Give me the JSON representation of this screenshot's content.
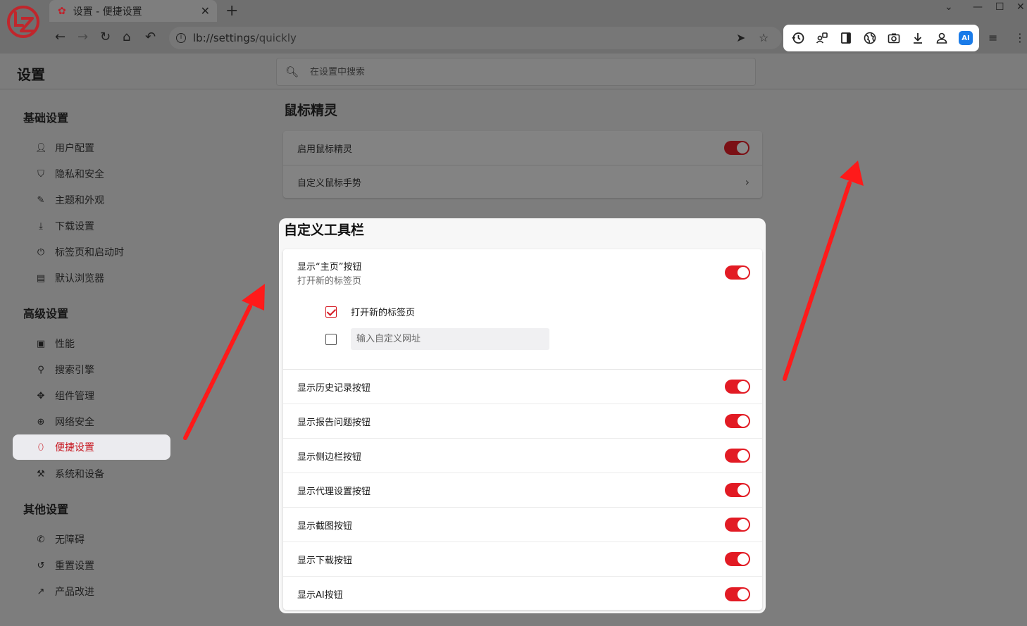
{
  "colors": {
    "accent": "#e21b24",
    "ai_badge": "#1a7be8",
    "annotation_arrow": "#ff1a1a"
  },
  "tab": {
    "title": "设置 - 便捷设置",
    "icon": "gear-icon"
  },
  "address_bar": {
    "host": "lb://settings",
    "path": "/quickly"
  },
  "toolbar_icons": [
    "history-icon",
    "proxy-icon",
    "sidebar-icon",
    "globe-icon",
    "camera-icon",
    "download-icon",
    "user-icon",
    "ai-icon"
  ],
  "ai_badge_label": "AI",
  "header": {
    "title": "设置",
    "search_placeholder": "在设置中搜索"
  },
  "sidebar": {
    "basic": {
      "title": "基础设置",
      "items": [
        {
          "label": "用户配置",
          "icon": "user-icon"
        },
        {
          "label": "隐私和安全",
          "icon": "shield-icon"
        },
        {
          "label": "主题和外观",
          "icon": "brush-icon"
        },
        {
          "label": "下载设置",
          "icon": "download-icon"
        },
        {
          "label": "标签页和启动时",
          "icon": "power-icon"
        },
        {
          "label": "默认浏览器",
          "icon": "browser-icon"
        }
      ]
    },
    "advanced": {
      "title": "高级设置",
      "items": [
        {
          "label": "性能",
          "icon": "performance-icon"
        },
        {
          "label": "搜索引擎",
          "icon": "search-icon"
        },
        {
          "label": "组件管理",
          "icon": "puzzle-icon"
        },
        {
          "label": "网络安全",
          "icon": "globe-icon"
        },
        {
          "label": "便捷设置",
          "icon": "mouse-icon",
          "active": true
        },
        {
          "label": "系统和设备",
          "icon": "wrench-icon"
        }
      ]
    },
    "other": {
      "title": "其他设置",
      "items": [
        {
          "label": "无障碍",
          "icon": "accessibility-icon"
        },
        {
          "label": "重置设置",
          "icon": "reset-icon"
        },
        {
          "label": "产品改进",
          "icon": "trend-icon"
        }
      ]
    }
  },
  "mouse_section": {
    "title": "鼠标精灵",
    "enable_label": "启用鼠标精灵",
    "enable_on": true,
    "gesture_label": "自定义鼠标手势"
  },
  "toolbar_section": {
    "title": "自定义工具栏",
    "home": {
      "label": "显示“主页”按钮",
      "desc": "打开新的标签页",
      "on": true,
      "option_newtab": "打开新的标签页",
      "option_newtab_checked": true,
      "custom_url_placeholder": "输入自定义网址",
      "custom_url_checked": false
    },
    "rows": [
      {
        "label": "显示历史记录按钮",
        "on": true
      },
      {
        "label": "显示报告问题按钮",
        "on": true
      },
      {
        "label": "显示侧边栏按钮",
        "on": true
      },
      {
        "label": "显示代理设置按钮",
        "on": true
      },
      {
        "label": "显示截图按钮",
        "on": true
      },
      {
        "label": "显示下载按钮",
        "on": true
      },
      {
        "label": "显示AI按钮",
        "on": true
      }
    ]
  }
}
